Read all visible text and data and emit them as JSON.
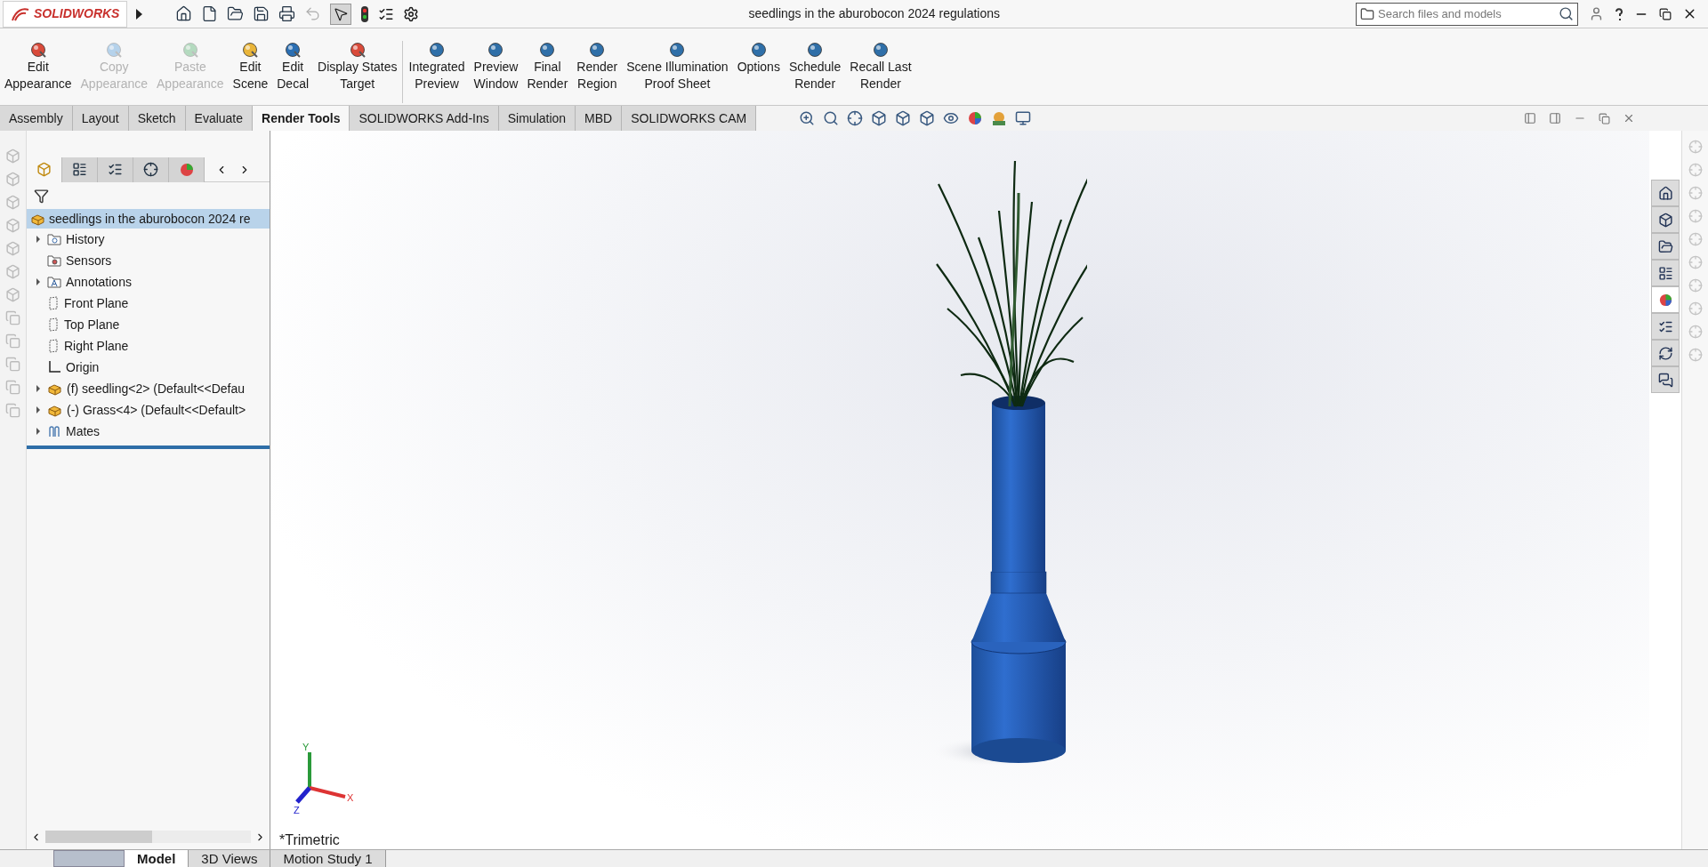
{
  "title_bar": {
    "app_name": "SOLIDWORKS",
    "document_title": "seedlings in the aburobocon 2024 regulations",
    "search": {
      "placeholder": "Search files and models"
    }
  },
  "ribbon": {
    "groups": [
      [
        {
          "lines": [
            "Edit",
            "Appearance"
          ],
          "disabled": false
        },
        {
          "lines": [
            "Copy",
            "Appearance"
          ],
          "disabled": true
        },
        {
          "lines": [
            "Paste",
            "Appearance"
          ],
          "disabled": true
        },
        {
          "lines": [
            "Edit",
            "Scene"
          ],
          "disabled": false
        },
        {
          "lines": [
            "Edit",
            "Decal"
          ],
          "disabled": false
        },
        {
          "lines": [
            "Display States",
            "Target"
          ],
          "disabled": false
        }
      ],
      [
        {
          "lines": [
            "Integrated",
            "Preview"
          ],
          "disabled": false
        },
        {
          "lines": [
            "Preview",
            "Window"
          ],
          "disabled": false
        },
        {
          "lines": [
            "Final",
            "Render"
          ],
          "disabled": false
        },
        {
          "lines": [
            "Render",
            "Region"
          ],
          "disabled": false
        },
        {
          "lines": [
            "Scene Illumination",
            "Proof Sheet"
          ],
          "disabled": false
        },
        {
          "lines": [
            "Options"
          ],
          "disabled": false
        },
        {
          "lines": [
            "Schedule",
            "Render"
          ],
          "disabled": false
        },
        {
          "lines": [
            "Recall Last",
            "Render"
          ],
          "disabled": false
        }
      ]
    ]
  },
  "tabs": [
    {
      "label": "Assembly",
      "selected": false
    },
    {
      "label": "Layout",
      "selected": false
    },
    {
      "label": "Sketch",
      "selected": false
    },
    {
      "label": "Evaluate",
      "selected": false
    },
    {
      "label": "Render Tools",
      "selected": true
    },
    {
      "label": "SOLIDWORKS Add-Ins",
      "selected": false
    },
    {
      "label": "Simulation",
      "selected": false
    },
    {
      "label": "MBD",
      "selected": false
    },
    {
      "label": "SOLIDWORKS CAM",
      "selected": false
    }
  ],
  "panel_tabs": [
    {
      "selected": true
    },
    {
      "selected": false
    },
    {
      "selected": false
    },
    {
      "selected": false
    },
    {
      "selected": false
    }
  ],
  "task_pane_tabs": [
    {
      "selected": false
    },
    {
      "selected": false
    },
    {
      "selected": false
    },
    {
      "selected": false
    },
    {
      "selected": true
    },
    {
      "selected": false
    },
    {
      "selected": false
    },
    {
      "selected": false
    }
  ],
  "feature_tree": {
    "root": {
      "label": "seedlings in the aburobocon 2024 re",
      "selected": true
    },
    "items": [
      {
        "kind": "folder",
        "label": "History",
        "expandable": true
      },
      {
        "kind": "sensor",
        "label": "Sensors",
        "expandable": false
      },
      {
        "kind": "annotation",
        "label": "Annotations",
        "expandable": true
      },
      {
        "kind": "plane",
        "label": "Front Plane",
        "expandable": false
      },
      {
        "kind": "plane",
        "label": "Top Plane",
        "expandable": false
      },
      {
        "kind": "plane",
        "label": "Right Plane",
        "expandable": false
      },
      {
        "kind": "origin",
        "label": "Origin",
        "expandable": false
      },
      {
        "kind": "part",
        "label": "(f) seedling<2> (Default<<Defau",
        "expandable": true
      },
      {
        "kind": "part",
        "label": "(-) Grass<4> (Default<<Default>",
        "expandable": true
      },
      {
        "kind": "mates",
        "label": "Mates",
        "expandable": true
      }
    ]
  },
  "viewport": {
    "triad": {
      "x": "X",
      "y": "Y",
      "z": "Z"
    },
    "view_name": "*Trimetric"
  },
  "bottom_tabs": [
    {
      "label": "Model",
      "selected": true
    },
    {
      "label": "3D Views",
      "selected": false
    },
    {
      "label": "Motion Study 1",
      "selected": false
    }
  ]
}
